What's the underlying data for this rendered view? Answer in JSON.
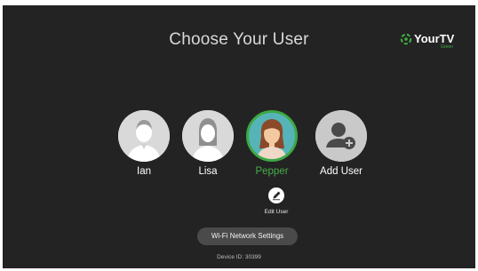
{
  "header": {
    "title": "Choose Your User",
    "logo": {
      "name": "YourTV",
      "sub": "Green",
      "accent": "#3fae43"
    }
  },
  "users": [
    {
      "name": "Ian",
      "selected": false,
      "icon": "male-avatar-icon"
    },
    {
      "name": "Lisa",
      "selected": false,
      "icon": "female-avatar-icon"
    },
    {
      "name": "Pepper",
      "selected": true,
      "icon": "female-avatar-icon",
      "highlight": "#3ea843"
    },
    {
      "name": "Add User",
      "selected": false,
      "icon": "add-user-icon"
    }
  ],
  "edit_user": {
    "label": "Edit User",
    "icon": "pencil-icon"
  },
  "wifi_button": {
    "label": "Wi-Fi Network Settings"
  },
  "device": {
    "label": "Device ID: 30399"
  }
}
